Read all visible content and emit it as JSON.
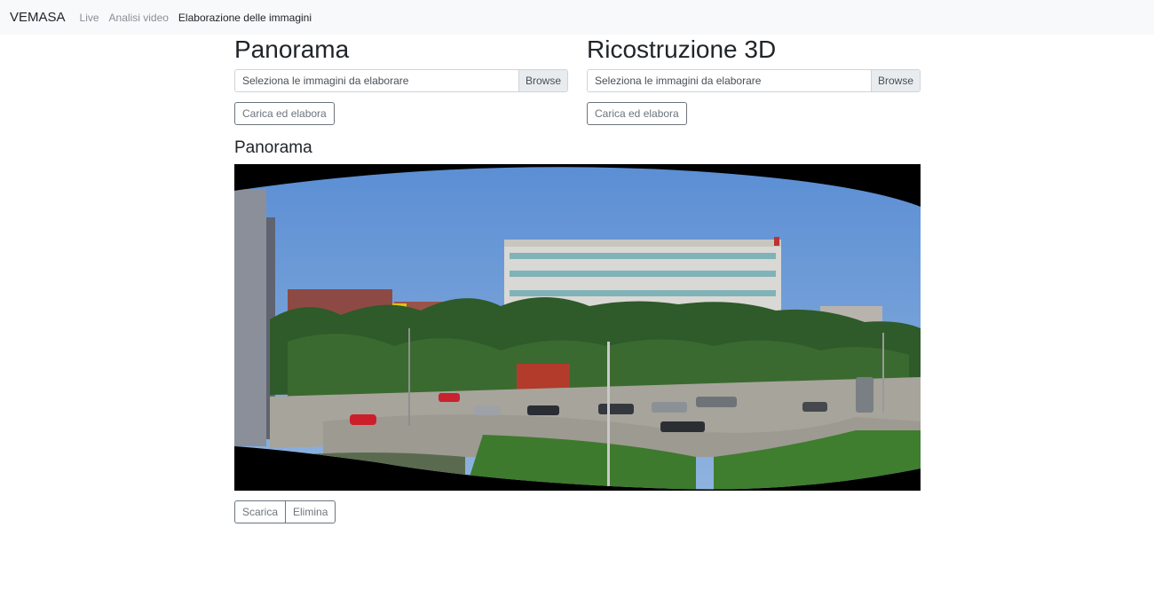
{
  "navbar": {
    "brand": "VEMASA",
    "links": [
      {
        "label": "Live",
        "active": false
      },
      {
        "label": "Analisi video",
        "active": false
      },
      {
        "label": "Elaborazione delle immagini",
        "active": true
      }
    ]
  },
  "panorama_form": {
    "title": "Panorama",
    "file_placeholder": "Seleziona le immagini da elaborare",
    "browse_label": "Browse",
    "submit_label": "Carica ed elabora"
  },
  "reconstruction_form": {
    "title": "Ricostruzione 3D",
    "file_placeholder": "Seleziona le immagini da elaborare",
    "browse_label": "Browse",
    "submit_label": "Carica ed elabora"
  },
  "result": {
    "title": "Panorama",
    "download_label": "Scarica",
    "delete_label": "Elimina"
  },
  "colors": {
    "navbar_bg": "#f8f9fa",
    "sky": "#6d9ad6",
    "trees": "#2f5a2a",
    "building": "#d9d8d4"
  }
}
